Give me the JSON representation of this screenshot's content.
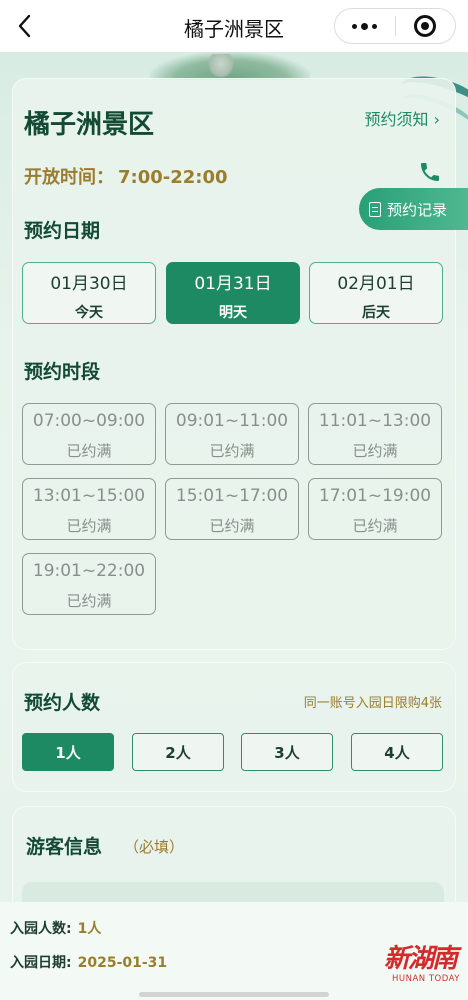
{
  "nav": {
    "title": "橘子洲景区"
  },
  "scenic": {
    "name": "橘子洲景区",
    "notice_link": "预约须知",
    "hours_label": "开放时间：",
    "hours_value": "7:00-22:00",
    "record_label": "预约记录"
  },
  "date_section": {
    "title": "预约日期",
    "dates": [
      {
        "date": "01月30日",
        "label": "今天"
      },
      {
        "date": "01月31日",
        "label": "明天",
        "selected": true
      },
      {
        "date": "02月01日",
        "label": "后天"
      }
    ]
  },
  "slot_section": {
    "title": "预约时段",
    "slots": [
      {
        "time": "07:00~09:00",
        "status": "已约满"
      },
      {
        "time": "09:01~11:00",
        "status": "已约满"
      },
      {
        "time": "11:01~13:00",
        "status": "已约满"
      },
      {
        "time": "13:01~15:00",
        "status": "已约满"
      },
      {
        "time": "15:01~17:00",
        "status": "已约满"
      },
      {
        "time": "17:01~19:00",
        "status": "已约满"
      },
      {
        "time": "19:01~22:00",
        "status": "已约满"
      }
    ]
  },
  "people_section": {
    "title": "预约人数",
    "limit_note": "同一账号入园日限购4张",
    "options": [
      "1人",
      "2人",
      "3人",
      "4人"
    ],
    "selected_index": 0
  },
  "visitor_section": {
    "title": "游客信息",
    "required_note": "（必填）"
  },
  "summary": {
    "count_label": "入园人数:",
    "count_value": "1人",
    "date_label": "入园日期:",
    "date_value": "2025-01-31"
  },
  "watermark": {
    "cn": "新湖南",
    "en": "HUNAN TODAY"
  },
  "colors": {
    "primary_green": "#1d8a63",
    "accent_gold": "#9b7d2e",
    "card_bg": "#e8f3ed"
  }
}
